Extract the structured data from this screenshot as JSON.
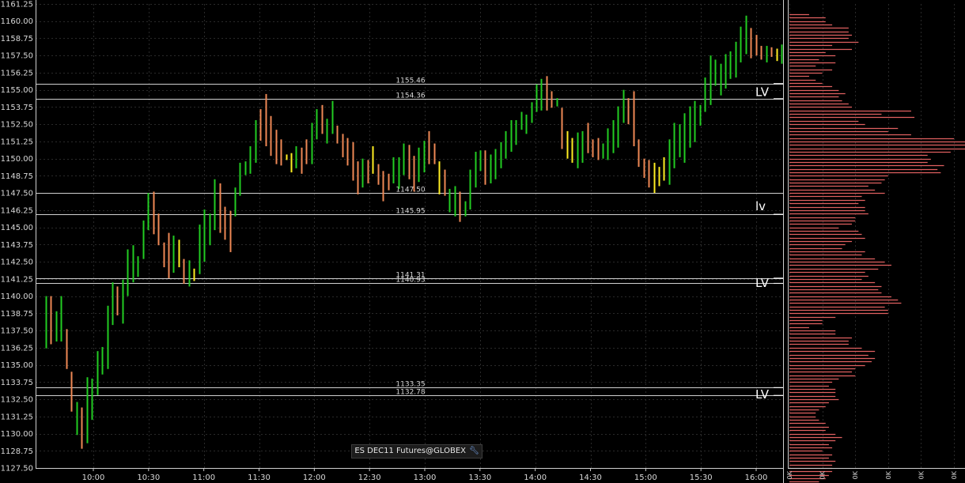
{
  "instrument_label": "ES DEC11 Futures@GLOBEX",
  "instrument_icon": "wrench-icon",
  "colors": {
    "background": "#000000",
    "grid": "#2a2a2a",
    "up": "#22cc22",
    "down": "#ee8855",
    "neutral": "#ffee22",
    "level_line": "#d0d0d0",
    "volume": "#e06060"
  },
  "chart_data": {
    "type": "ohlc",
    "title": "",
    "xlabel": "",
    "ylabel": "",
    "ylim": [
      1127.5,
      1161.25
    ],
    "yticks": [
      "1161.25",
      "1160.00",
      "1158.75",
      "1157.50",
      "1156.25",
      "1155.00",
      "1153.75",
      "1152.50",
      "1151.25",
      "1150.00",
      "1148.75",
      "1147.50",
      "1146.25",
      "1145.00",
      "1143.75",
      "1142.50",
      "1141.25",
      "1140.00",
      "1138.75",
      "1137.50",
      "1136.25",
      "1135.00",
      "1133.75",
      "1132.50",
      "1131.25",
      "1130.00",
      "1128.75",
      "1127.50"
    ],
    "xticks": [
      "10:00",
      "10:30",
      "11:00",
      "11:30",
      "12:00",
      "12:30",
      "13:00",
      "13:30",
      "14:00",
      "14:30",
      "15:00",
      "15:30",
      "16:00"
    ],
    "grid": true,
    "bars": [
      {
        "h": 1140.0,
        "l": 1136.2,
        "d": "up"
      },
      {
        "h": 1140.0,
        "l": 1136.5,
        "d": "down"
      },
      {
        "h": 1138.9,
        "l": 1136.7,
        "d": "up"
      },
      {
        "h": 1140.0,
        "l": 1136.7,
        "d": "up"
      },
      {
        "h": 1137.6,
        "l": 1134.7,
        "d": "down"
      },
      {
        "h": 1134.5,
        "l": 1131.6,
        "d": "down"
      },
      {
        "h": 1132.3,
        "l": 1129.9,
        "d": "up"
      },
      {
        "h": 1131.9,
        "l": 1128.9,
        "d": "down"
      },
      {
        "h": 1134.1,
        "l": 1129.3,
        "d": "up"
      },
      {
        "h": 1134.0,
        "l": 1131.0,
        "d": "up"
      },
      {
        "h": 1136.0,
        "l": 1132.8,
        "d": "up"
      },
      {
        "h": 1136.3,
        "l": 1134.3,
        "d": "up"
      },
      {
        "h": 1139.3,
        "l": 1134.7,
        "d": "up"
      },
      {
        "h": 1141.0,
        "l": 1137.9,
        "d": "up"
      },
      {
        "h": 1140.7,
        "l": 1138.6,
        "d": "down"
      },
      {
        "h": 1141.2,
        "l": 1138.0,
        "d": "up"
      },
      {
        "h": 1143.4,
        "l": 1140.0,
        "d": "up"
      },
      {
        "h": 1143.7,
        "l": 1141.0,
        "d": "up"
      },
      {
        "h": 1142.9,
        "l": 1141.4,
        "d": "up"
      },
      {
        "h": 1145.5,
        "l": 1142.7,
        "d": "up"
      },
      {
        "h": 1147.5,
        "l": 1144.8,
        "d": "up"
      },
      {
        "h": 1147.6,
        "l": 1144.5,
        "d": "down"
      },
      {
        "h": 1146.0,
        "l": 1143.7,
        "d": "down"
      },
      {
        "h": 1143.9,
        "l": 1142.1,
        "d": "down"
      },
      {
        "h": 1144.6,
        "l": 1141.3,
        "d": "down"
      },
      {
        "h": 1144.4,
        "l": 1141.7,
        "d": "up"
      },
      {
        "h": 1144.1,
        "l": 1142.1,
        "d": "neutral"
      },
      {
        "h": 1142.7,
        "l": 1140.9,
        "d": "down"
      },
      {
        "h": 1142.6,
        "l": 1140.7,
        "d": "up"
      },
      {
        "h": 1142.0,
        "l": 1141.1,
        "d": "neutral"
      },
      {
        "h": 1145.2,
        "l": 1141.6,
        "d": "up"
      },
      {
        "h": 1146.3,
        "l": 1142.5,
        "d": "up"
      },
      {
        "h": 1146.0,
        "l": 1143.7,
        "d": "up"
      },
      {
        "h": 1148.5,
        "l": 1144.8,
        "d": "up"
      },
      {
        "h": 1148.2,
        "l": 1144.6,
        "d": "down"
      },
      {
        "h": 1146.5,
        "l": 1144.1,
        "d": "down"
      },
      {
        "h": 1146.2,
        "l": 1143.2,
        "d": "down"
      },
      {
        "h": 1147.9,
        "l": 1145.8,
        "d": "up"
      },
      {
        "h": 1149.7,
        "l": 1147.3,
        "d": "up"
      },
      {
        "h": 1149.8,
        "l": 1148.8,
        "d": "up"
      },
      {
        "h": 1150.9,
        "l": 1148.9,
        "d": "up"
      },
      {
        "h": 1152.8,
        "l": 1149.7,
        "d": "up"
      },
      {
        "h": 1153.6,
        "l": 1151.3,
        "d": "down"
      },
      {
        "h": 1154.7,
        "l": 1150.9,
        "d": "down"
      },
      {
        "h": 1153.1,
        "l": 1150.2,
        "d": "down"
      },
      {
        "h": 1152.1,
        "l": 1149.6,
        "d": "down"
      },
      {
        "h": 1151.4,
        "l": 1149.5,
        "d": "down"
      },
      {
        "h": 1150.3,
        "l": 1149.9,
        "d": "neutral"
      },
      {
        "h": 1150.4,
        "l": 1149.0,
        "d": "neutral"
      },
      {
        "h": 1150.9,
        "l": 1149.3,
        "d": "up"
      },
      {
        "h": 1150.8,
        "l": 1148.9,
        "d": "down"
      },
      {
        "h": 1151.4,
        "l": 1149.6,
        "d": "down"
      },
      {
        "h": 1152.6,
        "l": 1149.6,
        "d": "up"
      },
      {
        "h": 1153.6,
        "l": 1151.4,
        "d": "up"
      },
      {
        "h": 1153.9,
        "l": 1151.8,
        "d": "down"
      },
      {
        "h": 1152.9,
        "l": 1151.1,
        "d": "up"
      },
      {
        "h": 1154.2,
        "l": 1151.8,
        "d": "up"
      },
      {
        "h": 1152.4,
        "l": 1151.1,
        "d": "down"
      },
      {
        "h": 1151.8,
        "l": 1150.1,
        "d": "down"
      },
      {
        "h": 1151.5,
        "l": 1149.5,
        "d": "down"
      },
      {
        "h": 1151.2,
        "l": 1148.4,
        "d": "down"
      },
      {
        "h": 1149.8,
        "l": 1147.4,
        "d": "down"
      },
      {
        "h": 1150.0,
        "l": 1147.9,
        "d": "up"
      },
      {
        "h": 1149.9,
        "l": 1148.2,
        "d": "down"
      },
      {
        "h": 1150.9,
        "l": 1148.9,
        "d": "neutral"
      },
      {
        "h": 1149.6,
        "l": 1148.1,
        "d": "down"
      },
      {
        "h": 1149.1,
        "l": 1146.9,
        "d": "down"
      },
      {
        "h": 1148.9,
        "l": 1147.7,
        "d": "down"
      },
      {
        "h": 1150.1,
        "l": 1148.2,
        "d": "up"
      },
      {
        "h": 1150.1,
        "l": 1147.8,
        "d": "up"
      },
      {
        "h": 1151.1,
        "l": 1148.8,
        "d": "up"
      },
      {
        "h": 1151.0,
        "l": 1148.5,
        "d": "down"
      },
      {
        "h": 1150.2,
        "l": 1147.6,
        "d": "down"
      },
      {
        "h": 1150.8,
        "l": 1148.3,
        "d": "up"
      },
      {
        "h": 1151.3,
        "l": 1149.0,
        "d": "up"
      },
      {
        "h": 1152.0,
        "l": 1149.6,
        "d": "down"
      },
      {
        "h": 1151.1,
        "l": 1149.6,
        "d": "down"
      },
      {
        "h": 1149.8,
        "l": 1147.4,
        "d": "neutral"
      },
      {
        "h": 1149.2,
        "l": 1147.3,
        "d": "down"
      },
      {
        "h": 1147.8,
        "l": 1146.1,
        "d": "up"
      },
      {
        "h": 1148.0,
        "l": 1145.8,
        "d": "up"
      },
      {
        "h": 1147.6,
        "l": 1145.4,
        "d": "down"
      },
      {
        "h": 1146.9,
        "l": 1145.8,
        "d": "up"
      },
      {
        "h": 1149.2,
        "l": 1146.3,
        "d": "up"
      },
      {
        "h": 1150.5,
        "l": 1147.9,
        "d": "up"
      },
      {
        "h": 1150.6,
        "l": 1149.1,
        "d": "up"
      },
      {
        "h": 1150.6,
        "l": 1148.1,
        "d": "down"
      },
      {
        "h": 1150.3,
        "l": 1148.2,
        "d": "up"
      },
      {
        "h": 1150.7,
        "l": 1148.5,
        "d": "up"
      },
      {
        "h": 1151.2,
        "l": 1149.3,
        "d": "up"
      },
      {
        "h": 1152.0,
        "l": 1150.0,
        "d": "up"
      },
      {
        "h": 1152.8,
        "l": 1150.5,
        "d": "up"
      },
      {
        "h": 1152.8,
        "l": 1151.0,
        "d": "up"
      },
      {
        "h": 1153.4,
        "l": 1152.1,
        "d": "up"
      },
      {
        "h": 1153.2,
        "l": 1151.8,
        "d": "up"
      },
      {
        "h": 1154.1,
        "l": 1152.6,
        "d": "up"
      },
      {
        "h": 1155.4,
        "l": 1153.4,
        "d": "up"
      },
      {
        "h": 1155.8,
        "l": 1153.5,
        "d": "up"
      },
      {
        "h": 1156.0,
        "l": 1153.5,
        "d": "down"
      },
      {
        "h": 1154.9,
        "l": 1153.7,
        "d": "down"
      },
      {
        "h": 1154.4,
        "l": 1153.8,
        "d": "up"
      },
      {
        "h": 1153.7,
        "l": 1150.7,
        "d": "down"
      },
      {
        "h": 1152.0,
        "l": 1150.0,
        "d": "neutral"
      },
      {
        "h": 1151.5,
        "l": 1149.7,
        "d": "neutral"
      },
      {
        "h": 1151.9,
        "l": 1149.3,
        "d": "up"
      },
      {
        "h": 1152.0,
        "l": 1149.7,
        "d": "up"
      },
      {
        "h": 1152.6,
        "l": 1150.4,
        "d": "down"
      },
      {
        "h": 1151.4,
        "l": 1150.1,
        "d": "down"
      },
      {
        "h": 1151.5,
        "l": 1149.9,
        "d": "down"
      },
      {
        "h": 1151.1,
        "l": 1150.0,
        "d": "up"
      },
      {
        "h": 1152.2,
        "l": 1149.9,
        "d": "up"
      },
      {
        "h": 1152.8,
        "l": 1150.4,
        "d": "up"
      },
      {
        "h": 1153.8,
        "l": 1150.8,
        "d": "up"
      },
      {
        "h": 1155.0,
        "l": 1152.6,
        "d": "up"
      },
      {
        "h": 1154.4,
        "l": 1152.5,
        "d": "down"
      },
      {
        "h": 1154.9,
        "l": 1150.9,
        "d": "down"
      },
      {
        "h": 1151.4,
        "l": 1149.4,
        "d": "down"
      },
      {
        "h": 1150.0,
        "l": 1148.6,
        "d": "down"
      },
      {
        "h": 1149.9,
        "l": 1147.9,
        "d": "down"
      },
      {
        "h": 1149.7,
        "l": 1147.5,
        "d": "neutral"
      },
      {
        "h": 1149.4,
        "l": 1148.0,
        "d": "neutral"
      },
      {
        "h": 1150.1,
        "l": 1148.4,
        "d": "neutral"
      },
      {
        "h": 1151.4,
        "l": 1148.1,
        "d": "up"
      },
      {
        "h": 1152.6,
        "l": 1149.3,
        "d": "up"
      },
      {
        "h": 1152.5,
        "l": 1150.1,
        "d": "up"
      },
      {
        "h": 1153.3,
        "l": 1149.7,
        "d": "up"
      },
      {
        "h": 1153.8,
        "l": 1150.8,
        "d": "up"
      },
      {
        "h": 1154.2,
        "l": 1151.2,
        "d": "up"
      },
      {
        "h": 1153.9,
        "l": 1152.4,
        "d": "up"
      },
      {
        "h": 1155.9,
        "l": 1153.4,
        "d": "up"
      },
      {
        "h": 1157.5,
        "l": 1153.9,
        "d": "up"
      },
      {
        "h": 1157.2,
        "l": 1155.3,
        "d": "up"
      },
      {
        "h": 1156.9,
        "l": 1154.6,
        "d": "up"
      },
      {
        "h": 1157.6,
        "l": 1155.1,
        "d": "up"
      },
      {
        "h": 1157.8,
        "l": 1155.8,
        "d": "up"
      },
      {
        "h": 1158.5,
        "l": 1155.9,
        "d": "up"
      },
      {
        "h": 1159.6,
        "l": 1157.0,
        "d": "up"
      },
      {
        "h": 1160.4,
        "l": 1157.6,
        "d": "up"
      },
      {
        "h": 1159.5,
        "l": 1157.3,
        "d": "down"
      },
      {
        "h": 1159.0,
        "l": 1157.5,
        "d": "down"
      },
      {
        "h": 1158.2,
        "l": 1157.2,
        "d": "down"
      },
      {
        "h": 1158.2,
        "l": 1157.0,
        "d": "up"
      },
      {
        "h": 1158.1,
        "l": 1157.4,
        "d": "down"
      },
      {
        "h": 1158.0,
        "l": 1157.1,
        "d": "neutral"
      },
      {
        "h": 1158.3,
        "l": 1156.9,
        "d": "up"
      }
    ],
    "levels": [
      {
        "value": 1155.46,
        "label": "1155.46"
      },
      {
        "value": 1154.36,
        "label": "1154.36"
      },
      {
        "value": 1147.5,
        "label": "1147.50"
      },
      {
        "value": 1145.95,
        "label": "1145.95"
      },
      {
        "value": 1141.31,
        "label": "1141.31"
      },
      {
        "value": 1140.93,
        "label": "1140.93"
      },
      {
        "value": 1133.35,
        "label": "1133.35"
      },
      {
        "value": 1132.78,
        "label": "1132.78"
      }
    ],
    "annotations": [
      {
        "text": "LV",
        "value": 1154.9,
        "bracket_top": 1155.46,
        "bracket_bottom": 1154.36
      },
      {
        "text": "lv",
        "value": 1146.6,
        "bracket_top": 1145.95,
        "bracket_bottom": 1145.95
      },
      {
        "text": "LV",
        "value": 1141.0,
        "bracket_top": 1141.31,
        "bracket_bottom": 1140.93
      },
      {
        "text": "LV",
        "value": 1132.9,
        "bracket_top": 1133.35,
        "bracket_bottom": 1132.78
      }
    ],
    "volume_profile": {
      "labels": [
        "0K",
        "0K",
        "0K",
        "0K",
        "0K",
        "0K"
      ],
      "tick_values": [
        0,
        10,
        20,
        30,
        40,
        50
      ],
      "tick_step": 0.25,
      "bins_top": 1160.5,
      "volumes": [
        6,
        11,
        11,
        13,
        18,
        18,
        19,
        18,
        21,
        13,
        19,
        11,
        14,
        9,
        14,
        8,
        13,
        10,
        6,
        8,
        10,
        13,
        15,
        17,
        15,
        16,
        18,
        19,
        37,
        28,
        38,
        21,
        23,
        33,
        30,
        37,
        50,
        58,
        67,
        67,
        49,
        42,
        43,
        42,
        47,
        45,
        46,
        30,
        29,
        28,
        24,
        26,
        29,
        22,
        23,
        21,
        23,
        23,
        24,
        20,
        20,
        19,
        15,
        21,
        22,
        23,
        19,
        17,
        16,
        23,
        22,
        26,
        29,
        31,
        27,
        23,
        24,
        22,
        26,
        28,
        27,
        28,
        31,
        33,
        34,
        29,
        30,
        30,
        14,
        10,
        10,
        6,
        14,
        14,
        19,
        18,
        18,
        22,
        26,
        24,
        26,
        25,
        23,
        20,
        19,
        20,
        15,
        13,
        12,
        14,
        14,
        14,
        15,
        12,
        11,
        9,
        8,
        8,
        9,
        11,
        12,
        11,
        14,
        16,
        14,
        12,
        13,
        10,
        13,
        12,
        14,
        13,
        13,
        13,
        12,
        11,
        9,
        6,
        10,
        5,
        4
      ]
    }
  }
}
